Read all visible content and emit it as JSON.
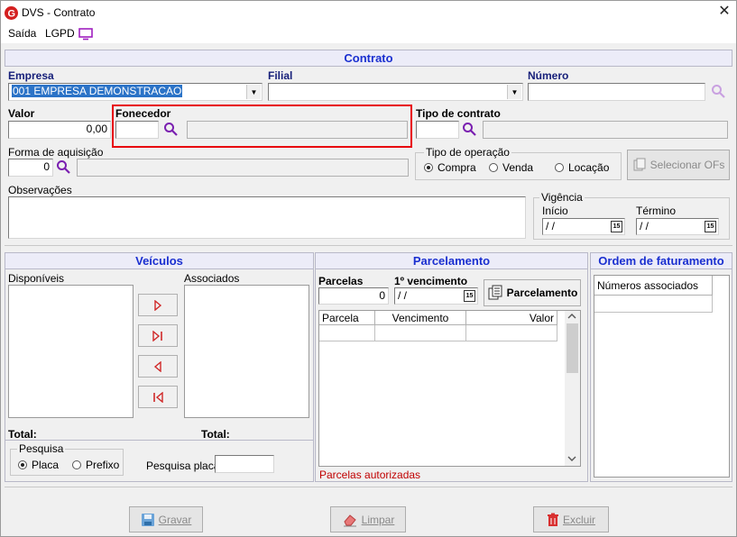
{
  "window": {
    "title": "DVS - Contrato",
    "close_glyph": "✕"
  },
  "menu": {
    "items": [
      "Saída",
      "LGPD"
    ]
  },
  "contrato": {
    "header": "Contrato",
    "empresa_label": "Empresa",
    "empresa_value": "001 EMPRESA DEMONSTRACAO",
    "filial_label": "Filial",
    "filial_value": "",
    "numero_label": "Número",
    "numero_value": "",
    "valor_label": "Valor",
    "valor_value": "0,00",
    "fornecedor_label": "Fonecedor",
    "fornecedor_code": "",
    "fornecedor_name": "",
    "tipo_contrato_label": "Tipo de contrato",
    "tipo_contrato_code": "",
    "tipo_contrato_name": "",
    "forma_label": "Forma de aquisição",
    "forma_code": "0",
    "forma_name": "",
    "tipo_operacao_label": "Tipo de operação",
    "operacoes": [
      {
        "label": "Compra",
        "selected": true
      },
      {
        "label": "Venda",
        "selected": false
      },
      {
        "label": "Locação",
        "selected": false
      }
    ],
    "selecionar_label": "Selecionar OFs",
    "observacoes_label": "Observações",
    "observacoes_value": "",
    "vigencia_label": "Vigência",
    "inicio_label": "Início",
    "inicio_value": "/ /",
    "termino_label": "Término",
    "termino_value": "/ /",
    "calendar_glyph": "15"
  },
  "veiculos": {
    "header": "Veículos",
    "disponiveis_label": "Disponíveis",
    "associados_label": "Associados",
    "total_label_left": "Total:",
    "total_label_right": "Total:",
    "pesquisa_label": "Pesquisa",
    "pesquisa_options": [
      {
        "label": "Placa",
        "selected": true
      },
      {
        "label": "Prefixo",
        "selected": false
      }
    ],
    "pesquisa_placa_label": "Pesquisa placa",
    "pesquisa_placa_value": ""
  },
  "parcelamento": {
    "header": "Parcelamento",
    "parcelas_label": "Parcelas",
    "parcelas_value": "0",
    "vencimento_label": "1º vencimento",
    "vencimento_value": "/ /",
    "button_label": "Parcelamento",
    "columns": [
      "Parcela",
      "Vencimento",
      "Valor"
    ],
    "note": "Parcelas autorizadas"
  },
  "ordem": {
    "header": "Ordem de faturamento",
    "column": "Números associados"
  },
  "footer": {
    "gravar": "Gravar",
    "limpar": "Limpar",
    "excluir": "Excluir"
  },
  "colors": {
    "panel_title": "#1a2fd0",
    "highlight": "#e8000b",
    "search_icon": "#7a1fb0",
    "note": "#c00000"
  }
}
